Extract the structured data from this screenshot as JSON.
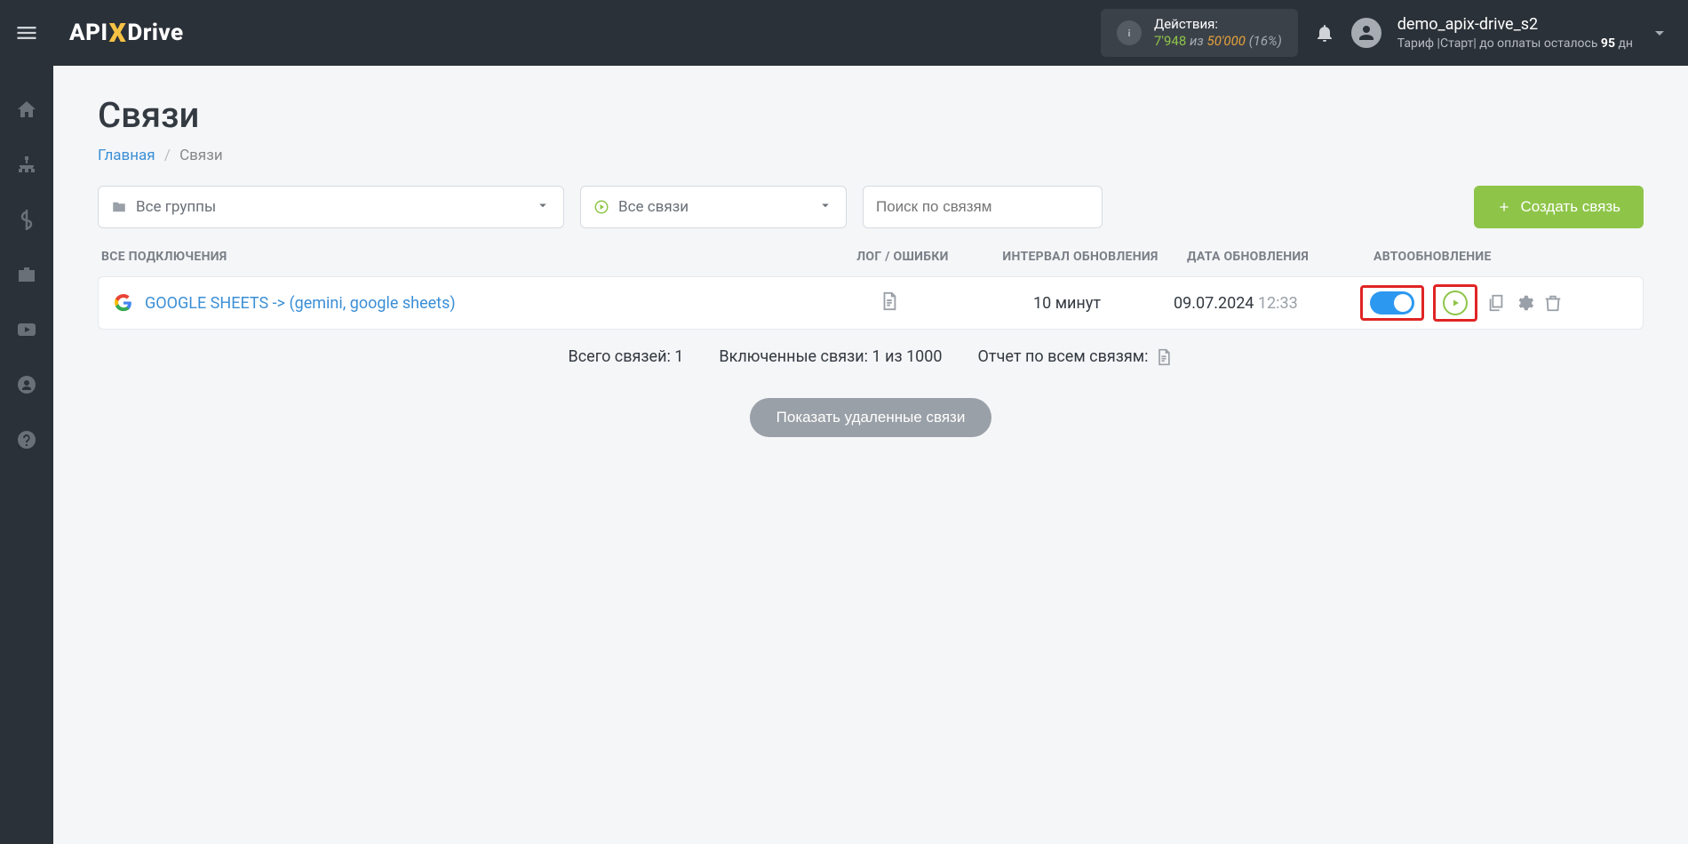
{
  "brand": {
    "part1": "API",
    "x": "X",
    "part2": "Drive"
  },
  "header": {
    "actions_label": "Действия:",
    "actions_used": "7'948",
    "actions_of_word": "из",
    "actions_total": "50'000",
    "actions_pct": "(16%)",
    "username": "demo_apix-drive_s2",
    "plan_prefix": "Тариф |Старт| до оплаты осталось ",
    "plan_days": "95",
    "plan_suffix": " дн"
  },
  "page": {
    "title": "Связи",
    "breadcrumb_home": "Главная",
    "breadcrumb_current": "Связи"
  },
  "filters": {
    "groups_label": "Все группы",
    "conns_label": "Все связи",
    "search_placeholder": "Поиск по связям",
    "create_label": "Создать связь"
  },
  "columns": {
    "name": "ВСЕ ПОДКЛЮЧЕНИЯ",
    "log": "ЛОГ / ОШИБКИ",
    "interval": "ИНТЕРВАЛ ОБНОВЛЕНИЯ",
    "date": "ДАТА ОБНОВЛЕНИЯ",
    "auto": "АВТООБНОВЛЕНИЕ"
  },
  "row": {
    "name": "GOOGLE SHEETS -> (gemini, google sheets)",
    "interval": "10 минут",
    "date": "09.07.2024",
    "time": "12:33"
  },
  "summary": {
    "total": "Всего связей: 1",
    "enabled": "Включенные связи: 1 из 1000",
    "report": "Отчет по всем связям:"
  },
  "show_deleted": "Показать удаленные связи"
}
